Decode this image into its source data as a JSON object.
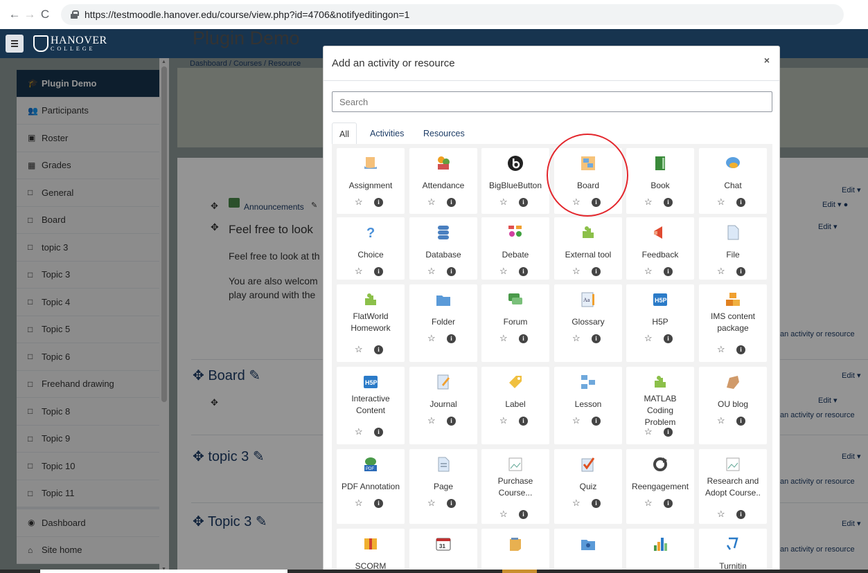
{
  "browser": {
    "url": "https://testmoodle.hanover.edu/course/view.php?id=4706&notifyeditingon=1"
  },
  "logo": {
    "line1": "HANOVER",
    "line2": "COLLEGE"
  },
  "drawer": {
    "items": [
      {
        "label": "Plugin Demo",
        "icon": "graduation-cap-icon",
        "glyph": "🎓"
      },
      {
        "label": "Participants",
        "icon": "users-icon",
        "glyph": "👥"
      },
      {
        "label": "Roster",
        "icon": "roster-icon",
        "glyph": "▣"
      },
      {
        "label": "Grades",
        "icon": "table-icon",
        "glyph": "▦"
      },
      {
        "label": "General",
        "icon": "folder-icon",
        "glyph": "□"
      },
      {
        "label": "Board",
        "icon": "folder-icon",
        "glyph": "□"
      },
      {
        "label": "topic 3",
        "icon": "folder-icon",
        "glyph": "□"
      },
      {
        "label": "Topic 3",
        "icon": "folder-icon",
        "glyph": "□"
      },
      {
        "label": "Topic 4",
        "icon": "folder-icon",
        "glyph": "□"
      },
      {
        "label": "Topic 5",
        "icon": "folder-icon",
        "glyph": "□"
      },
      {
        "label": "Topic 6",
        "icon": "folder-icon",
        "glyph": "□"
      },
      {
        "label": "Freehand drawing",
        "icon": "folder-icon",
        "glyph": "□"
      },
      {
        "label": "Topic 8",
        "icon": "folder-icon",
        "glyph": "□"
      },
      {
        "label": "Topic 9",
        "icon": "folder-icon",
        "glyph": "□"
      },
      {
        "label": "Topic 10",
        "icon": "folder-icon",
        "glyph": "□"
      },
      {
        "label": "Topic 11",
        "icon": "folder-icon",
        "glyph": "□"
      }
    ],
    "bottom_items": [
      {
        "label": "Dashboard",
        "icon": "dashboard-icon",
        "glyph": "◉"
      },
      {
        "label": "Site home",
        "icon": "home-icon",
        "glyph": "⌂"
      }
    ]
  },
  "course": {
    "title": "Plugin Demo",
    "breadcrumb": "Dashboard / Courses / Resource",
    "announcements": "Announcements",
    "intro_heading": "Feel free to look",
    "intro_line1": "Feel free to look at th",
    "intro_line2": "You are also welcom",
    "intro_line3": "play around with the",
    "sections": [
      "Board",
      "topic 3",
      "Topic 3"
    ],
    "edit_label": "Edit",
    "add_activity_label": "an activity or resource"
  },
  "modal": {
    "title": "Add an activity or resource",
    "close": "×",
    "search_placeholder": "Search",
    "tabs": [
      "All",
      "Activities",
      "Resources"
    ],
    "items": [
      {
        "name": "Assignment",
        "icon": "assignment-icon"
      },
      {
        "name": "Attendance",
        "icon": "attendance-icon"
      },
      {
        "name": "BigBlueButton",
        "icon": "bigbluebutton-icon"
      },
      {
        "name": "Board",
        "icon": "board-icon"
      },
      {
        "name": "Book",
        "icon": "book-icon"
      },
      {
        "name": "Chat",
        "icon": "chat-icon"
      },
      {
        "name": "Choice",
        "icon": "choice-icon"
      },
      {
        "name": "Database",
        "icon": "database-icon"
      },
      {
        "name": "Debate",
        "icon": "debate-icon"
      },
      {
        "name": "External tool",
        "icon": "external-tool-icon"
      },
      {
        "name": "Feedback",
        "icon": "feedback-icon"
      },
      {
        "name": "File",
        "icon": "file-icon"
      },
      {
        "name": "FlatWorld Homework",
        "icon": "flatworld-icon"
      },
      {
        "name": "Folder",
        "icon": "folder-icon"
      },
      {
        "name": "Forum",
        "icon": "forum-icon"
      },
      {
        "name": "Glossary",
        "icon": "glossary-icon"
      },
      {
        "name": "H5P",
        "icon": "h5p-icon"
      },
      {
        "name": "IMS content package",
        "icon": "ims-icon"
      },
      {
        "name": "Interactive Content",
        "icon": "h5p-icon"
      },
      {
        "name": "Journal",
        "icon": "journal-icon"
      },
      {
        "name": "Label",
        "icon": "label-icon"
      },
      {
        "name": "Lesson",
        "icon": "lesson-icon"
      },
      {
        "name": "MATLAB Coding Problem",
        "icon": "matlab-icon"
      },
      {
        "name": "OU blog",
        "icon": "blog-icon"
      },
      {
        "name": "PDF Annotation",
        "icon": "pdf-icon"
      },
      {
        "name": "Page",
        "icon": "page-icon"
      },
      {
        "name": "Purchase Course...",
        "icon": "broken-image-icon"
      },
      {
        "name": "Quiz",
        "icon": "quiz-icon"
      },
      {
        "name": "Reengagement",
        "icon": "reengagement-icon"
      },
      {
        "name": "Research and Adopt Course..",
        "icon": "broken-image-icon"
      },
      {
        "name": "SCORM",
        "icon": "scorm-icon"
      },
      {
        "name": "",
        "icon": "calendar-icon"
      },
      {
        "name": "",
        "icon": "sticky-note-icon"
      },
      {
        "name": "",
        "icon": "group-folder-icon"
      },
      {
        "name": "",
        "icon": "chart-icon"
      },
      {
        "name": "Turnitin",
        "icon": "turnitin-icon"
      }
    ]
  }
}
